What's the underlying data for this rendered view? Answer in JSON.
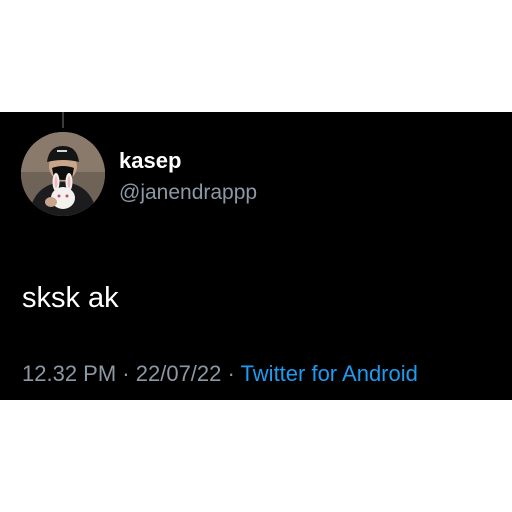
{
  "tweet": {
    "author": {
      "display_name": "kasep",
      "handle": "@janendrappp",
      "avatar": "profile-photo"
    },
    "text": "sksk ak",
    "time": "12.32 PM",
    "separator": "·",
    "date": "22/07/22",
    "source": "Twitter for Android"
  },
  "colors": {
    "background": "#000000",
    "primary_text": "#ffffff",
    "secondary_text": "#8b98a5",
    "link": "#1d9bf0"
  }
}
